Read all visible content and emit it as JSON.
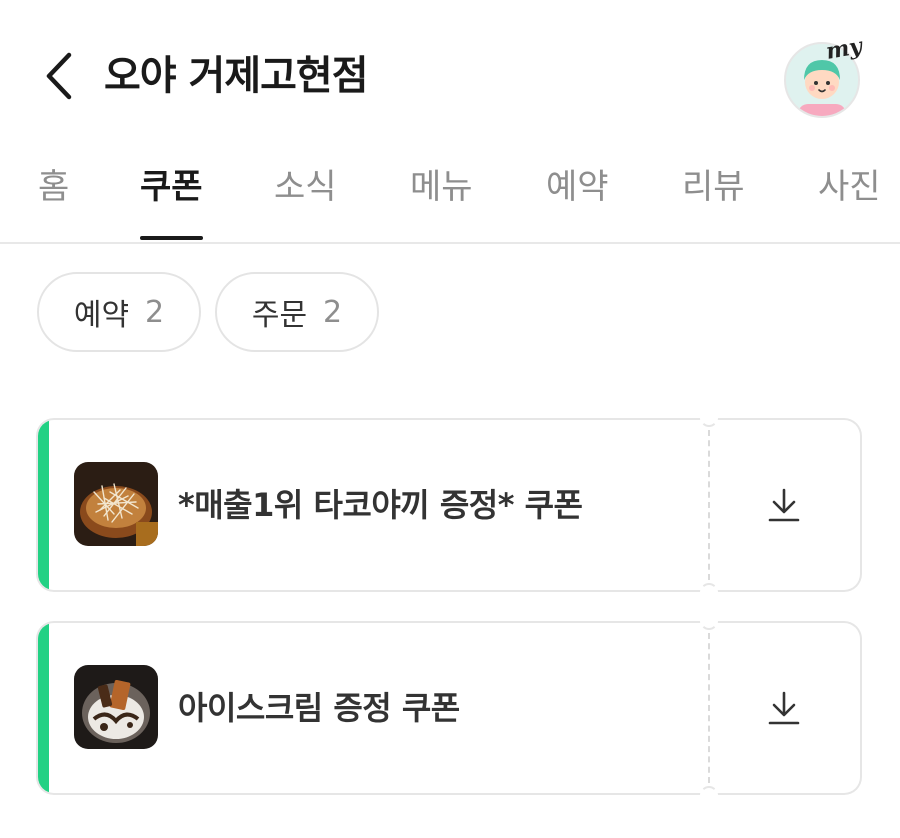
{
  "header": {
    "store_name": "오야 거제고현점",
    "avatar_badge": "my",
    "back_icon": "chevron-left-icon",
    "avatar_icon": "user-avatar-icon"
  },
  "tabs": [
    {
      "label": "홈",
      "active": false
    },
    {
      "label": "쿠폰",
      "active": true
    },
    {
      "label": "소식",
      "active": false
    },
    {
      "label": "메뉴",
      "active": false
    },
    {
      "label": "예약",
      "active": false
    },
    {
      "label": "리뷰",
      "active": false
    },
    {
      "label": "사진",
      "active": false
    }
  ],
  "filters": [
    {
      "label": "예약",
      "count": "2"
    },
    {
      "label": "주문",
      "count": "2"
    }
  ],
  "coupons": [
    {
      "title": "*매출1위 타코야끼 증정* 쿠폰",
      "image": "takoyaki-photo",
      "action_icon": "download-icon"
    },
    {
      "title": "아이스크림 증정 쿠폰",
      "image": "ice-cream-photo",
      "action_icon": "download-icon"
    }
  ],
  "colors": {
    "accent": "#22d184",
    "text_primary": "#1a1a1a",
    "text_muted": "#8e8e8e",
    "border": "#e6e6e6"
  }
}
